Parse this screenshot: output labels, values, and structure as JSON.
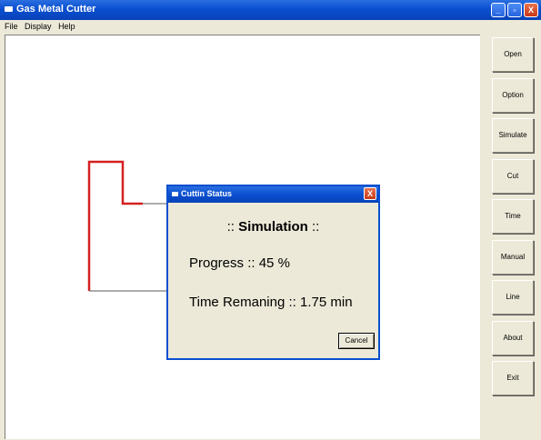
{
  "window": {
    "title": "Gas Metal Cutter",
    "controls": {
      "minimize": "_",
      "maximize": "▫",
      "close": "X"
    }
  },
  "menu": [
    "File",
    "Display",
    "Help"
  ],
  "sidebar": {
    "buttons": [
      "Open",
      "Option",
      "Simulate",
      "Cut",
      "Time",
      "Manual",
      "Line",
      "About",
      "Exit"
    ]
  },
  "dialog": {
    "title": "Cuttin Status",
    "close": "X",
    "heading_prefix": "::",
    "heading_word": "Simulation",
    "heading_suffix": "::",
    "progress_label": "Progress",
    "progress_value": "45",
    "progress_unit": "%",
    "time_label": "Time Remaning",
    "time_value": "1.75",
    "time_unit": "min",
    "separator": "::",
    "cancel_label": "Cancel"
  },
  "colors": {
    "cut_path": "#d42020",
    "uncut_path": "#7a7a7a",
    "title_blue": "#0a4fd0"
  }
}
